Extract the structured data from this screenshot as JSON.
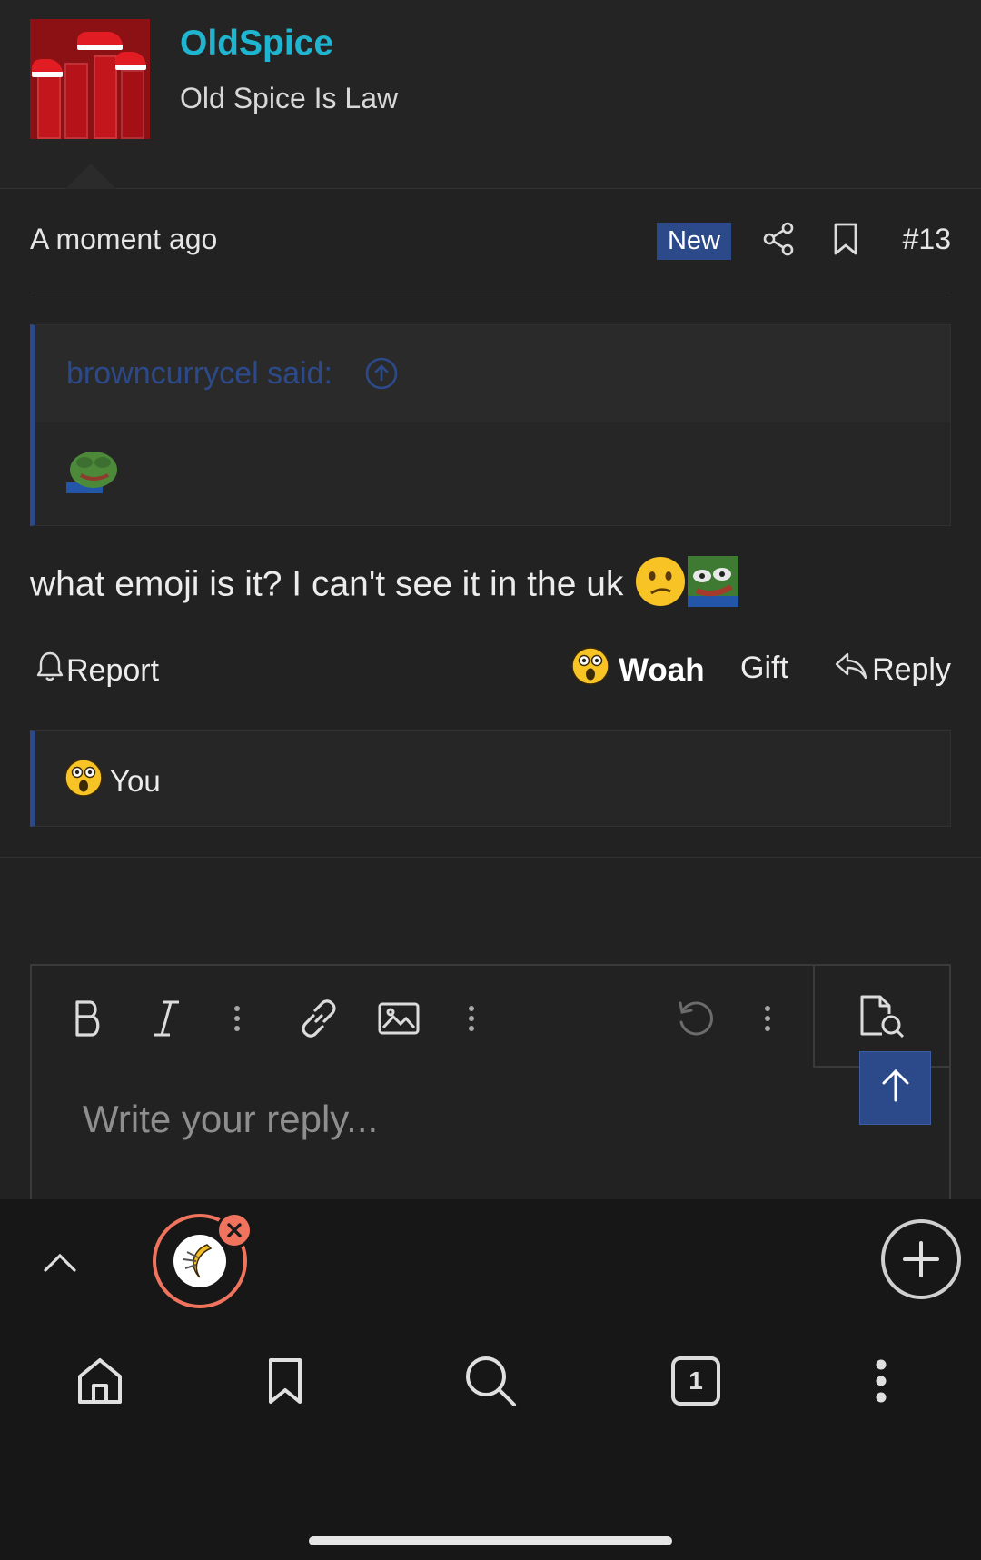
{
  "user": {
    "name": "OldSpice",
    "title": "Old Spice Is Law"
  },
  "post": {
    "time": "A moment ago",
    "badge": "New",
    "number": "#13",
    "quote_author": "browncurrycel said:",
    "message": "what emoji is it? I can't see it in the uk"
  },
  "actions": {
    "report": "Report",
    "reaction": "Woah",
    "gift": "Gift",
    "reply": "Reply"
  },
  "reactions": {
    "user": "You"
  },
  "editor": {
    "placeholder": "Write your reply..."
  },
  "browser": {
    "tab_count": "1"
  },
  "colors": {
    "accent": "#2c4a8a",
    "username": "#1fb5d0",
    "bubble": "#f0735d"
  },
  "icons": [
    "share-icon",
    "bookmark-icon",
    "arrow-up-circle-icon",
    "bell-icon",
    "reply-icon",
    "bold-icon",
    "italic-icon",
    "more-vertical-icon",
    "link-icon",
    "image-icon",
    "undo-icon",
    "preview-icon",
    "arrow-up-icon",
    "chevron-up-icon",
    "plus-icon",
    "home-icon",
    "search-icon",
    "tabs-icon"
  ]
}
